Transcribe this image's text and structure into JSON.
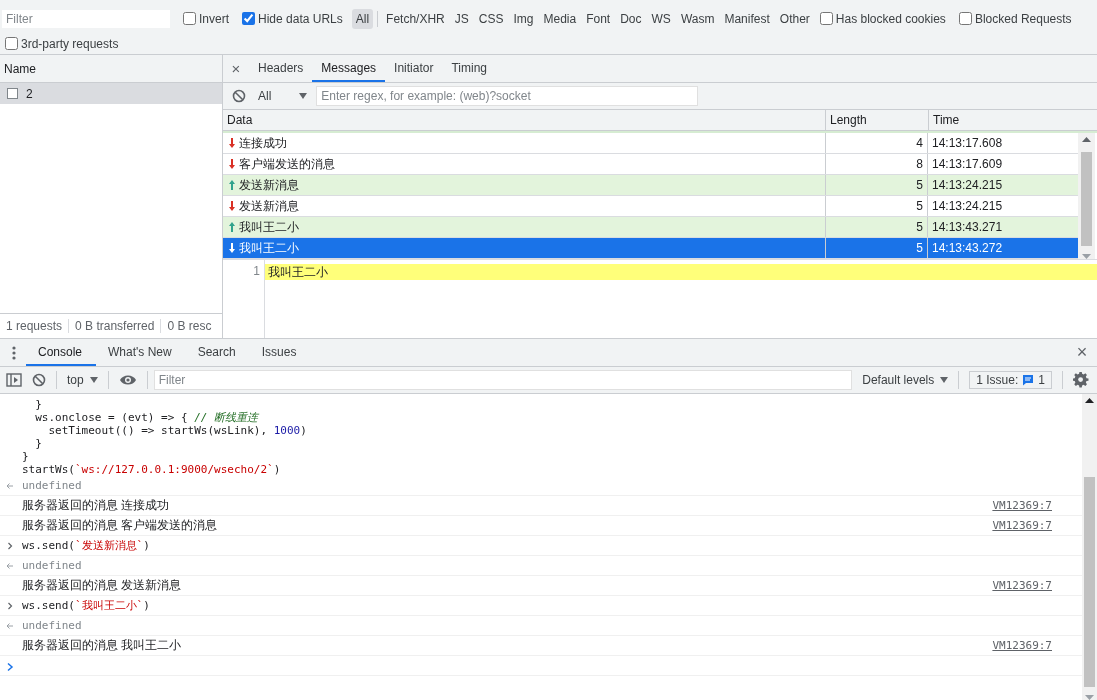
{
  "filter_bar": {
    "filter": {
      "placeholder": "Filter"
    },
    "invert": {
      "label": "Invert",
      "checked": false
    },
    "hide_data_urls": {
      "label": "Hide data URLs",
      "checked": true
    },
    "types": [
      {
        "label": "All",
        "selected": true
      },
      {
        "label": "Fetch/XHR",
        "selected": false
      },
      {
        "label": "JS",
        "selected": false
      },
      {
        "label": "CSS",
        "selected": false
      },
      {
        "label": "Img",
        "selected": false
      },
      {
        "label": "Media",
        "selected": false
      },
      {
        "label": "Font",
        "selected": false
      },
      {
        "label": "Doc",
        "selected": false
      },
      {
        "label": "WS",
        "selected": false
      },
      {
        "label": "Wasm",
        "selected": false
      },
      {
        "label": "Manifest",
        "selected": false
      },
      {
        "label": "Other",
        "selected": false
      }
    ],
    "options": [
      {
        "label": "Has blocked cookies",
        "checked": false
      },
      {
        "label": "Blocked Requests",
        "checked": false
      },
      {
        "label": "3rd-party requests",
        "checked": false
      }
    ]
  },
  "requests": {
    "column": "Name",
    "rows": [
      {
        "name": "2",
        "selected": true,
        "checked": false
      }
    ],
    "status": [
      "1 requests",
      "0 B transferred",
      "0 B resc"
    ]
  },
  "detail": {
    "close": "×",
    "tabs": [
      {
        "label": "Headers",
        "selected": false
      },
      {
        "label": "Messages",
        "selected": true
      },
      {
        "label": "Initiator",
        "selected": false
      },
      {
        "label": "Timing",
        "selected": false
      }
    ],
    "message_filter": "All",
    "search": {
      "placeholder": "Enter regex, for example: (web)?socket"
    },
    "columns": [
      "Data",
      "Length",
      "Time"
    ],
    "messages": [
      {
        "kind": "received",
        "data": "连接成功",
        "length": "4",
        "time": "14:13:17.608",
        "selected": false
      },
      {
        "kind": "received",
        "data": "客户端发送的消息",
        "length": "8",
        "time": "14:13:17.609",
        "selected": false
      },
      {
        "kind": "sent",
        "data": "发送新消息",
        "length": "5",
        "time": "14:13:24.215",
        "selected": false
      },
      {
        "kind": "received",
        "data": "发送新消息",
        "length": "5",
        "time": "14:13:24.215",
        "selected": false
      },
      {
        "kind": "sent",
        "data": "我叫王二小",
        "length": "5",
        "time": "14:13:43.271",
        "selected": false
      },
      {
        "kind": "received",
        "data": "我叫王二小",
        "length": "5",
        "time": "14:13:43.272",
        "selected": true
      }
    ],
    "preview": {
      "line_number": "1",
      "text": "我叫王二小"
    }
  },
  "drawer": {
    "tabs": [
      {
        "label": "Console",
        "selected": true
      },
      {
        "label": "What's New",
        "selected": false
      },
      {
        "label": "Search",
        "selected": false
      },
      {
        "label": "Issues",
        "selected": false
      }
    ],
    "close": "×"
  },
  "console_toolbar": {
    "context": "top",
    "filter": {
      "placeholder": "Filter"
    },
    "levels": "Default levels",
    "issues": {
      "label": "1 Issue:",
      "count": "1"
    }
  },
  "console": [
    {
      "kind": "code",
      "parts": [
        {
          "kind": "plain",
          "text": "  }"
        }
      ]
    },
    {
      "kind": "code",
      "parts": [
        {
          "kind": "plain",
          "text": "  ws.onclose = (evt) => { "
        },
        {
          "kind": "comment",
          "text": "// 断线重连"
        }
      ]
    },
    {
      "kind": "code",
      "parts": [
        {
          "kind": "plain",
          "text": "    setTimeout(() => startWs(wsLink), "
        },
        {
          "kind": "number",
          "text": "1000"
        },
        {
          "kind": "plain",
          "text": ")"
        }
      ]
    },
    {
      "kind": "code",
      "parts": [
        {
          "kind": "plain",
          "text": "  }"
        }
      ]
    },
    {
      "kind": "code",
      "parts": [
        {
          "kind": "plain",
          "text": "}"
        }
      ]
    },
    {
      "kind": "code",
      "parts": [
        {
          "kind": "plain",
          "text": "startWs("
        },
        {
          "kind": "string",
          "text": "`ws://127.0.0.1:9000/wsecho/2`"
        },
        {
          "kind": "plain",
          "text": ")"
        }
      ]
    },
    {
      "kind": "result",
      "text": "undefined"
    },
    {
      "kind": "log",
      "text": "服务器返回的消息 连接成功",
      "source": "VM12369:7"
    },
    {
      "kind": "log",
      "text": "服务器返回的消息 客户端发送的消息",
      "source": "VM12369:7"
    },
    {
      "kind": "input",
      "parts": [
        {
          "kind": "plain",
          "text": "ws.send("
        },
        {
          "kind": "string",
          "text": "`发送新消息`"
        },
        {
          "kind": "plain",
          "text": ")"
        }
      ]
    },
    {
      "kind": "result",
      "text": "undefined"
    },
    {
      "kind": "log",
      "text": "服务器返回的消息 发送新消息",
      "source": "VM12369:7"
    },
    {
      "kind": "input",
      "parts": [
        {
          "kind": "plain",
          "text": "ws.send("
        },
        {
          "kind": "string",
          "text": "`我叫王二小`"
        },
        {
          "kind": "plain",
          "text": ")"
        }
      ]
    },
    {
      "kind": "result",
      "text": "undefined"
    },
    {
      "kind": "log",
      "text": "服务器返回的消息 我叫王二小",
      "source": "VM12369:7"
    },
    {
      "kind": "prompt"
    }
  ]
}
